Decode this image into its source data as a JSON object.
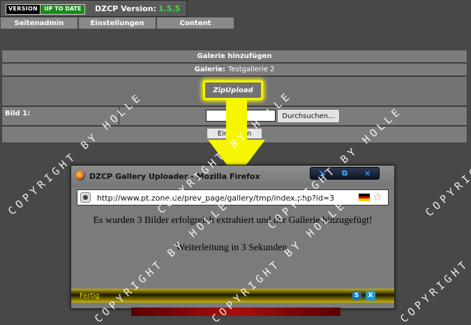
{
  "header": {
    "badge_left": "VERSION",
    "badge_right": "UP TO DATE",
    "version_label": "DZCP Version:",
    "version_number": "1.5.5"
  },
  "nav": {
    "items": [
      "Seitenadmin",
      "Einstellungen",
      "Content"
    ]
  },
  "panel": {
    "title": "Galerie hinzufügen",
    "gallery_label": "Galerie:",
    "gallery_name": "Testgallerie 2",
    "zip_button": "ZipUpload",
    "image_label": "Bild 1:",
    "browse_button": "Durchsuchen...",
    "submit_button": "Eintragen"
  },
  "popup": {
    "title": "DZCP Gallery Uploader - Mozilla Firefox",
    "controls": [
      "⇲",
      "⧉",
      "✕"
    ],
    "url": "http://www.pt.zone.de/prev_page/gallery/tmp/index.php?id=3",
    "message": "Es wurden 3 Bilder erfolgreich extrahiert und der Gallerie hinzugefügt!",
    "redirect": "Weiterleitung in 3 Sekunden.",
    "status": "Fertig",
    "status_icons": [
      "S",
      "X"
    ],
    "flag_colors": [
      "#000000",
      "#dd0000",
      "#ffce00"
    ]
  },
  "watermark": "COPYRIGHT BY HOLLE",
  "colors": {
    "highlight": "#f4f400",
    "version_green": "#4ad34a",
    "badge_green": "#188c18"
  }
}
